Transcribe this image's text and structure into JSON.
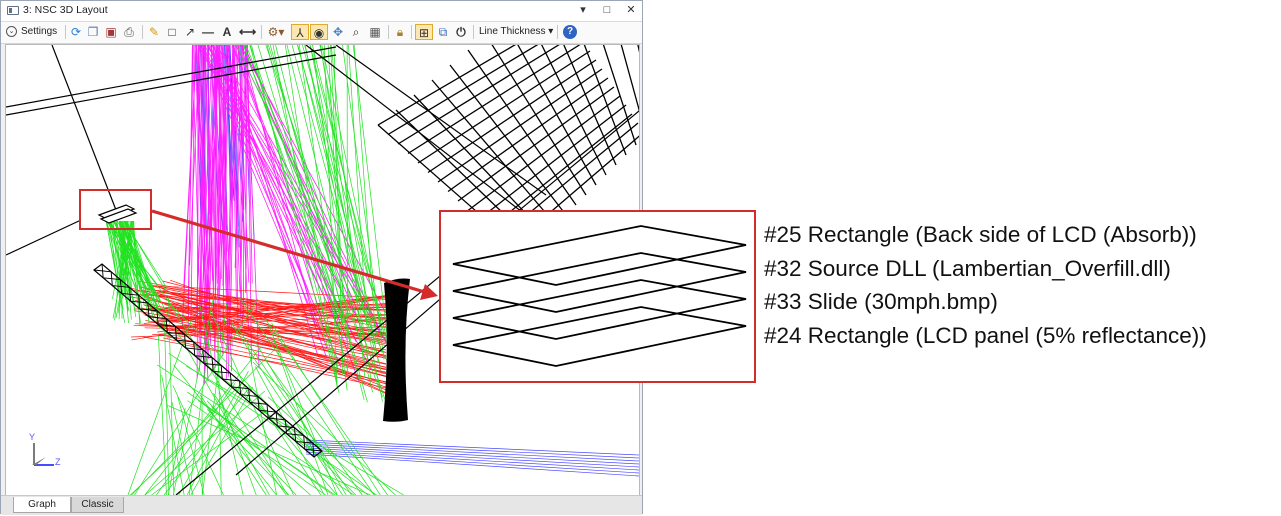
{
  "window": {
    "title": "3: NSC 3D Layout",
    "controls": [
      "▾",
      "□",
      "✕"
    ]
  },
  "toolbar": {
    "settings_label": "Settings",
    "line_thickness_label": "Line Thickness ▾",
    "help_label": "?"
  },
  "tabs": [
    {
      "label": "Graph",
      "active": true
    },
    {
      "label": "Classic",
      "active": false
    }
  ],
  "axes": {
    "y_label": "Y",
    "z_label": "Z"
  },
  "annotations": [
    "#25 Rectangle (Back side of LCD (Absorb))",
    "#32 Source DLL (Lambertian_Overfill.dll)",
    "#33 Slide (30mph.bmp)",
    "#24 Rectangle (LCD panel (5% reflectance))"
  ],
  "colors": {
    "highlight": "#d42b2b",
    "ray_green": "#21e221",
    "ray_magenta": "#ff21ff",
    "ray_red": "#ff1a1a",
    "ray_blue": "#4a4aff",
    "selected_tool": "#fbe7b0"
  }
}
